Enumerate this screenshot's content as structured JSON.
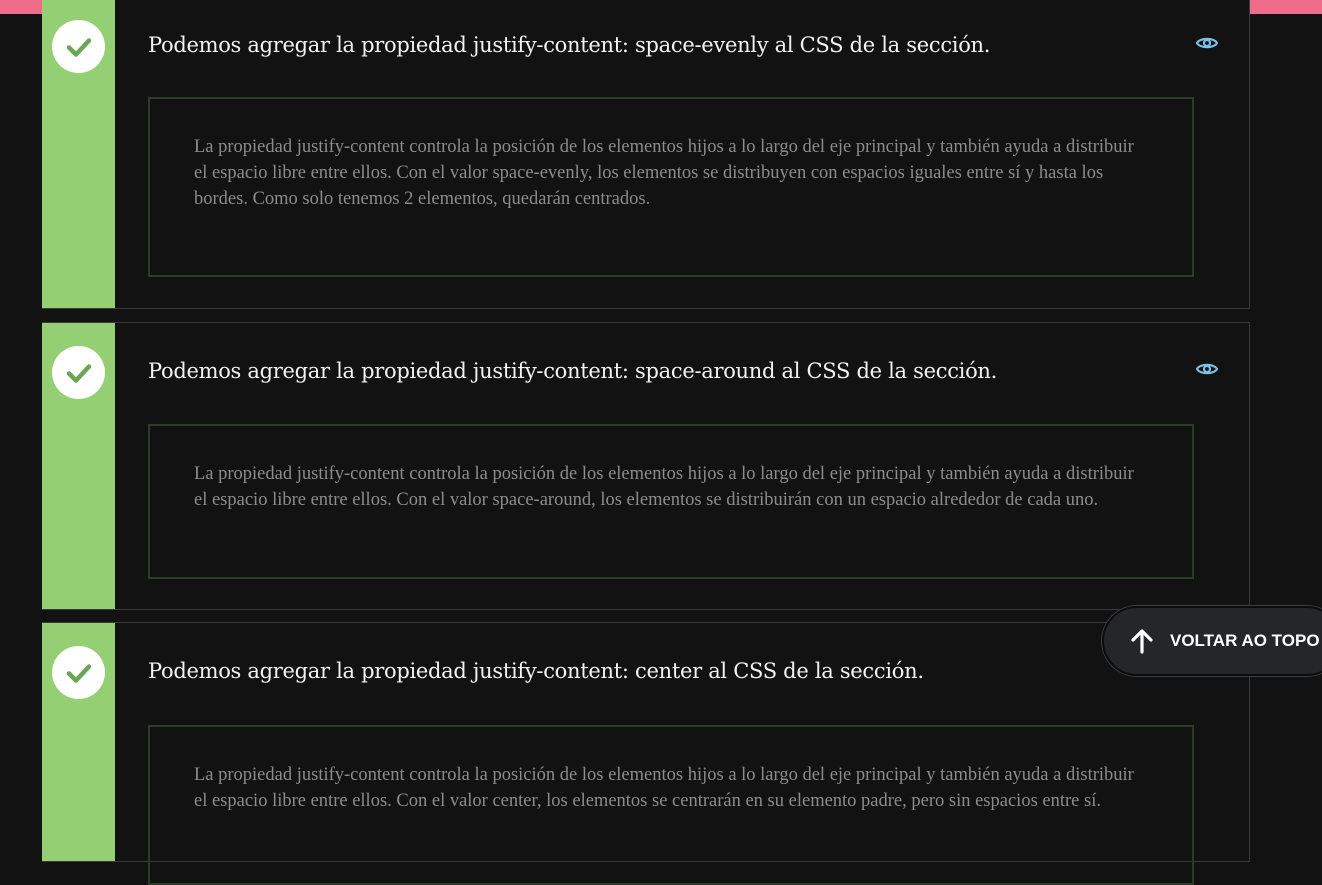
{
  "colors": {
    "accent_bar": "#ee6b8a",
    "correct_stripe": "#95cf74",
    "check_mark": "#6aa655",
    "eye_icon": "#7cc0e6",
    "background": "#121212"
  },
  "questions": [
    {
      "title": "Podemos agregar la propiedad justify-content: space-evenly al CSS de la sección.",
      "explanation": "La propiedad justify-content controla la posición de los elementos hijos a lo largo del eje principal y también ayuda a distribuir el espacio libre entre ellos. Con el valor space-evenly, los elementos se distribuyen con espacios iguales entre sí y hasta los bordes. Como solo tenemos 2 elementos, quedarán centrados.",
      "status_icon": "check-icon",
      "toggle_icon": "eye-icon"
    },
    {
      "title": "Podemos agregar la propiedad justify-content: space-around al CSS de la sección.",
      "explanation": "La propiedad justify-content controla la posición de los elementos hijos a lo largo del eje principal y también ayuda a distribuir el espacio libre entre ellos. Con el valor space-around, los elementos se distribuirán con un espacio alrededor de cada uno.",
      "status_icon": "check-icon",
      "toggle_icon": "eye-icon"
    },
    {
      "title": "Podemos agregar la propiedad justify-content: center al CSS de la sección.",
      "explanation": "La propiedad justify-content controla la posición de los elementos hijos a lo largo del eje principal y también ayuda a distribuir el espacio libre entre ellos. Con el valor center, los elementos se centrarán en su elemento padre, pero sin espacios entre sí.",
      "status_icon": "check-icon"
    }
  ],
  "back_to_top": {
    "label": "VOLTAR AO TOPO",
    "icon": "arrow-up-icon"
  }
}
